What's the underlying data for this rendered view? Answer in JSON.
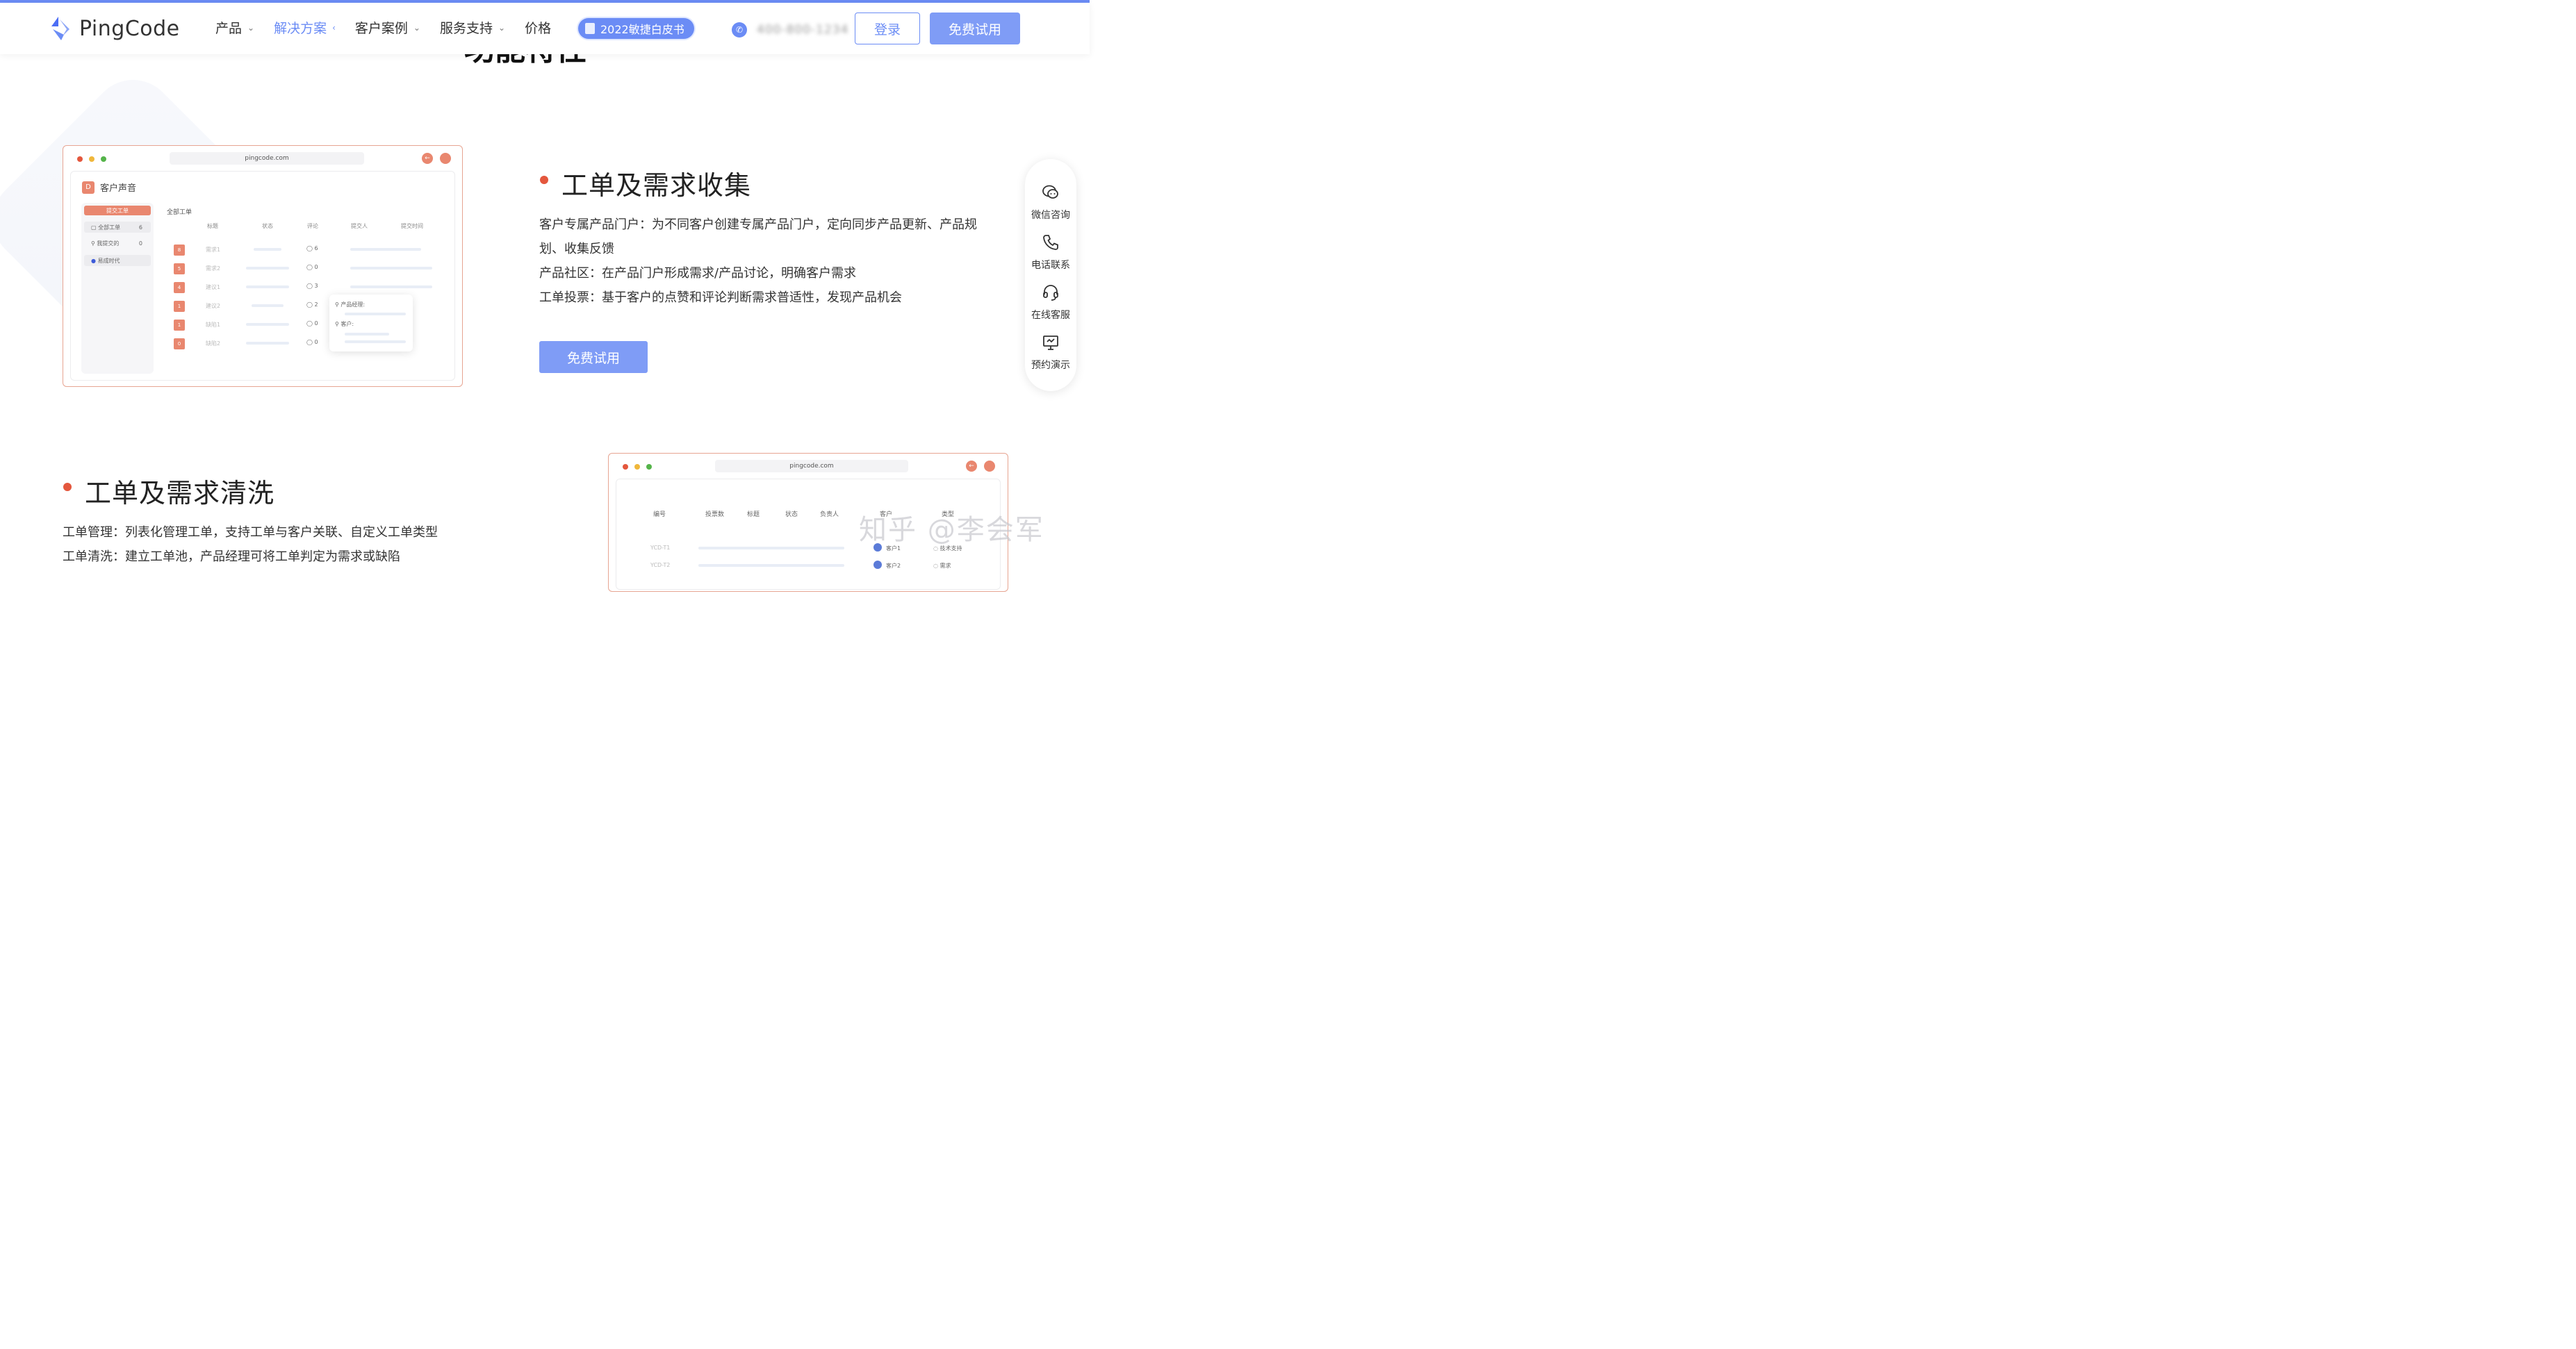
{
  "header": {
    "logo_text": "PingCode",
    "nav": [
      {
        "label": "产品",
        "chevron": "⌄"
      },
      {
        "label": "解决方案",
        "chevron": "‹"
      },
      {
        "label": "客户案例",
        "chevron": "⌄"
      },
      {
        "label": "服务支持",
        "chevron": "⌄"
      },
      {
        "label": "价格",
        "chevron": ""
      }
    ],
    "whitepaper": "2022敏捷白皮书",
    "phone": "400-800-1234",
    "login": "登录",
    "free_trial": "免费试用"
  },
  "section_title": "功能特性",
  "mock1": {
    "url": "pingcode.com",
    "app_title": "客户声音",
    "submit_button": "提交工单",
    "sidebar": [
      {
        "label": "全部工单",
        "count": "6"
      },
      {
        "label": "我提交的",
        "count": "0"
      },
      {
        "label": "易成时代",
        "count": ""
      }
    ],
    "table_title": "全部工单",
    "columns": [
      "标题",
      "状态",
      "评论",
      "提交人",
      "提交时间"
    ],
    "rows": [
      {
        "votes": "8",
        "title": "需求1",
        "comments": "6"
      },
      {
        "votes": "5",
        "title": "需求2",
        "comments": "0"
      },
      {
        "votes": "4",
        "title": "建议1",
        "comments": "3"
      },
      {
        "votes": "1",
        "title": "建议2",
        "comments": "2"
      },
      {
        "votes": "1",
        "title": "缺陷1",
        "comments": "0"
      },
      {
        "votes": "0",
        "title": "缺陷2",
        "comments": "0"
      }
    ],
    "popup": {
      "pm": "产品经理:",
      "customer": "客户:"
    }
  },
  "feature1": {
    "title": "工单及需求收集",
    "lines": [
      "客户专属产品门户：为不同客户创建专属产品门户，定向同步产品更新、产品规",
      "划、收集反馈",
      "产品社区：在产品门户形成需求/产品讨论，明确客户需求",
      "工单投票：基于客户的点赞和评论判断需求普适性，发现产品机会"
    ],
    "button": "免费试用"
  },
  "feature2": {
    "title": "工单及需求清洗",
    "lines": [
      "工单管理：列表化管理工单，支持工单与客户关联、自定义工单类型",
      "工单清洗：建立工单池，产品经理可将工单判定为需求或缺陷"
    ]
  },
  "mock2": {
    "url": "pingcode.com",
    "columns": [
      "编号",
      "投票数",
      "标题",
      "状态",
      "负责人",
      "客户",
      "类型"
    ],
    "rows": [
      {
        "id": "YCD-T1",
        "customer": "客户1",
        "type": "技术支持"
      },
      {
        "id": "YCD-T2",
        "customer": "客户2",
        "type": "需求"
      }
    ]
  },
  "float_bar": [
    {
      "label": "微信咨询",
      "icon": "wechat-icon"
    },
    {
      "label": "电话联系",
      "icon": "phone-icon"
    },
    {
      "label": "在线客服",
      "icon": "headset-icon"
    },
    {
      "label": "预约演示",
      "icon": "presentation-icon"
    }
  ],
  "watermark": "知乎 @李会军",
  "colors": {
    "accent": "#6b8cf5",
    "brand_orange": "#e9876f",
    "bullet_red": "#e4573d"
  }
}
